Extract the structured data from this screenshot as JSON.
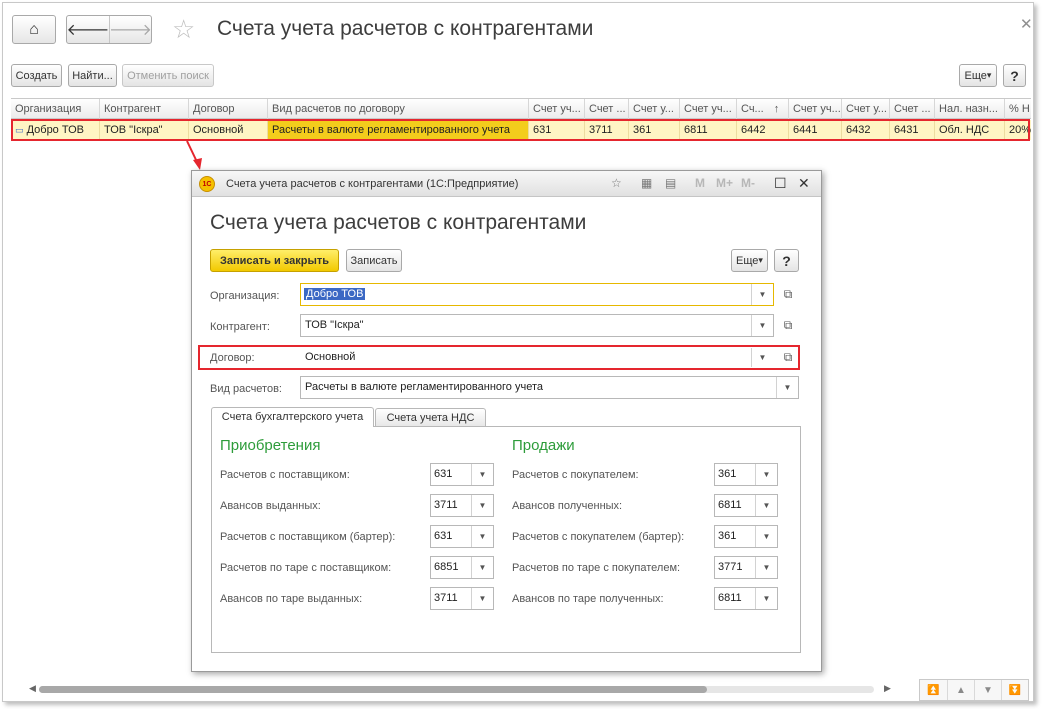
{
  "window": {
    "title": "Счета учета расчетов с контрагентами"
  },
  "toolbar": {
    "create": "Создать",
    "find": "Найти...",
    "cancel_search": "Отменить поиск",
    "more": "Еще",
    "help": "?"
  },
  "table": {
    "columns": [
      "Организация",
      "Контрагент",
      "Договор",
      "Вид расчетов по договору",
      "Счет уч...",
      "Счет ...",
      "Счет у...",
      "Счет уч...",
      "Сч...",
      "Счет уч...",
      "Счет у...",
      "Счет ...",
      "Нал. назн...",
      "% Н"
    ],
    "rows": [
      [
        "Добро ТОВ",
        "ТОВ \"Іскра\"",
        "Основной",
        "Расчеты в валюте регламентированного учета",
        "631",
        "3711",
        "361",
        "6811",
        "6442",
        "6441",
        "6432",
        "6431",
        "Обл. НДС",
        "20%"
      ]
    ]
  },
  "dialog": {
    "caption": "Счета учета расчетов с контрагентами  (1С:Предприятие)",
    "logo_text": "1С",
    "title": "Счета учета расчетов с контрагентами",
    "save_close": "Записать и закрыть",
    "save": "Записать",
    "more": "Еще",
    "help": "?",
    "fields": {
      "organization": {
        "label": "Организация:",
        "value": "Добро ТОВ"
      },
      "counterparty": {
        "label": "Контрагент:",
        "value": "ТОВ \"Іскра\""
      },
      "contract": {
        "label": "Договор:",
        "value": "Основной"
      },
      "settlement_type": {
        "label": "Вид расчетов:",
        "value": "Расчеты в валюте регламентированного учета"
      }
    },
    "tabs": [
      "Счета бухгалтерского учета",
      "Счета учета НДС"
    ],
    "purchases": {
      "title": "Приобретения",
      "rows": [
        {
          "label": "Расчетов с поставщиком:",
          "value": "631"
        },
        {
          "label": "Авансов выданных:",
          "value": "3711"
        },
        {
          "label": "Расчетов с поставщиком (бартер):",
          "value": "631"
        },
        {
          "label": "Расчетов по таре с поставщиком:",
          "value": "6851"
        },
        {
          "label": "Авансов по таре выданных:",
          "value": "3711"
        }
      ]
    },
    "sales": {
      "title": "Продажи",
      "rows": [
        {
          "label": "Расчетов с покупателем:",
          "value": "361"
        },
        {
          "label": "Авансов полученных:",
          "value": "6811"
        },
        {
          "label": "Расчетов с покупателем (бартер):",
          "value": "361"
        },
        {
          "label": "Расчетов по таре с покупателем:",
          "value": "3771"
        },
        {
          "label": "Авансов по таре полученных:",
          "value": "6811"
        }
      ]
    }
  },
  "colors": {
    "accent_yellow": "#f2c900",
    "highlight_red": "#e5262e",
    "section_green": "#2d9c3a",
    "selection_blue": "#3b68c4"
  }
}
